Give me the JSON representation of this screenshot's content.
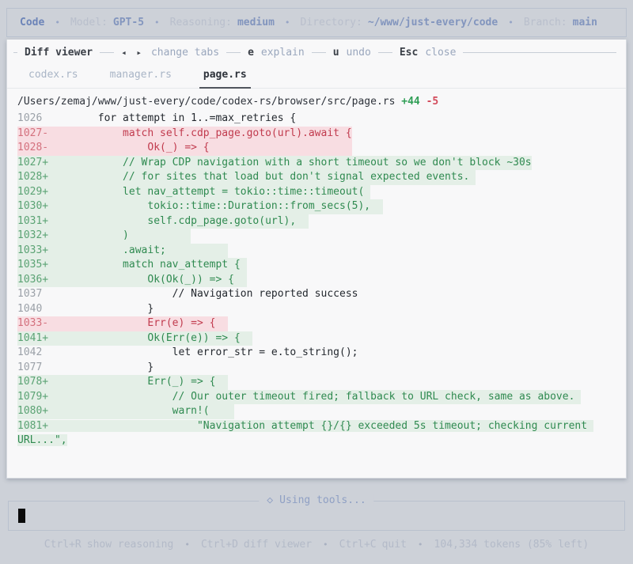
{
  "titlebar": {
    "app": "Code",
    "bullet": "•",
    "model_label": "Model:",
    "model_value": "GPT-5",
    "reasoning_label": "Reasoning:",
    "reasoning_value": "medium",
    "directory_label": "Directory:",
    "directory_value": "~/www/just-every/code",
    "branch_label": "Branch:",
    "branch_value": "main"
  },
  "diff_viewer": {
    "title": "Diff viewer",
    "hints": {
      "tabs_key": "◂ ▸",
      "tabs_label": "change tabs",
      "explain_key": "e",
      "explain_label": "explain",
      "undo_key": "u",
      "undo_label": "undo",
      "close_key": "Esc",
      "close_label": "close"
    },
    "tabs": [
      {
        "label": "codex.rs",
        "active": false
      },
      {
        "label": "manager.rs",
        "active": false
      },
      {
        "label": "page.rs",
        "active": true
      }
    ],
    "file": {
      "path": "/Users/zemaj/www/just-every/code/codex-rs/browser/src/page.rs",
      "additions": "+44",
      "deletions": "-5"
    },
    "lines": [
      {
        "num": "1026",
        "sign": " ",
        "type": "ctx",
        "text": "        for attempt in 1..=max_retries {"
      },
      {
        "num": "1027",
        "sign": "-",
        "type": "del",
        "text": "            match self.cdp_page.goto(url).await {"
      },
      {
        "num": "1028",
        "sign": "-",
        "type": "del",
        "text": "                Ok(_) => {                       "
      },
      {
        "num": "1027",
        "sign": "+",
        "type": "add",
        "text": "            // Wrap CDP navigation with a short timeout so we don't block ~30s"
      },
      {
        "num": "1028",
        "sign": "+",
        "type": "add",
        "text": "            // for sites that load but don't signal expected events. "
      },
      {
        "num": "1029",
        "sign": "+",
        "type": "add",
        "text": "            let nav_attempt = tokio::time::timeout( "
      },
      {
        "num": "1030",
        "sign": "+",
        "type": "add",
        "text": "                tokio::time::Duration::from_secs(5),  "
      },
      {
        "num": "1031",
        "sign": "+",
        "type": "add",
        "text": "                self.cdp_page.goto(url),  "
      },
      {
        "num": "1032",
        "sign": "+",
        "type": "add",
        "text": "            )          "
      },
      {
        "num": "1033",
        "sign": "+",
        "type": "add",
        "text": "            .await;          "
      },
      {
        "num": "1035",
        "sign": "+",
        "type": "add",
        "text": "            match nav_attempt { "
      },
      {
        "num": "1036",
        "sign": "+",
        "type": "add",
        "text": "                Ok(Ok(_)) => {  "
      },
      {
        "num": "1037",
        "sign": " ",
        "type": "ctx",
        "text": "                    // Navigation reported success"
      },
      {
        "num": "1040",
        "sign": " ",
        "type": "ctx",
        "text": "                }"
      },
      {
        "num": "1033",
        "sign": "-",
        "type": "del",
        "text": "                Err(e) => {  "
      },
      {
        "num": "1041",
        "sign": "+",
        "type": "add",
        "text": "                Ok(Err(e)) => {  "
      },
      {
        "num": "1042",
        "sign": " ",
        "type": "ctx",
        "text": "                    let error_str = e.to_string();"
      },
      {
        "num": "1077",
        "sign": " ",
        "type": "ctx",
        "text": "                }"
      },
      {
        "num": "1078",
        "sign": "+",
        "type": "add",
        "text": "                Err(_) => {  "
      },
      {
        "num": "1079",
        "sign": "+",
        "type": "add",
        "text": "                    // Our outer timeout fired; fallback to URL check, same as above. "
      },
      {
        "num": "1080",
        "sign": "+",
        "type": "add",
        "text": "                    warn!(    "
      },
      {
        "num": "1081",
        "sign": "+",
        "type": "add",
        "wrap": true,
        "text": "                        \"Navigation attempt {}/{} exceeded 5s timeout; checking current URL...\","
      }
    ]
  },
  "composer": {
    "icon": "◇",
    "title": "Using tools..."
  },
  "statusbar": {
    "bullet": "•",
    "reasoning_key": "Ctrl+R",
    "reasoning_label": "show reasoning",
    "diff_key": "Ctrl+D",
    "diff_label": "diff viewer",
    "quit_key": "Ctrl+C",
    "quit_label": "quit",
    "tokens": "104,334 tokens (85% left)"
  },
  "colors": {
    "page_bg": "#cdd1d8",
    "panel_bg": "#f8f8f9",
    "accent_blue": "#8295be",
    "added_bg": "#e4efe7",
    "added_text": "#2f8a50",
    "removed_bg": "#f8dde2",
    "removed_text": "#c13b4e"
  }
}
